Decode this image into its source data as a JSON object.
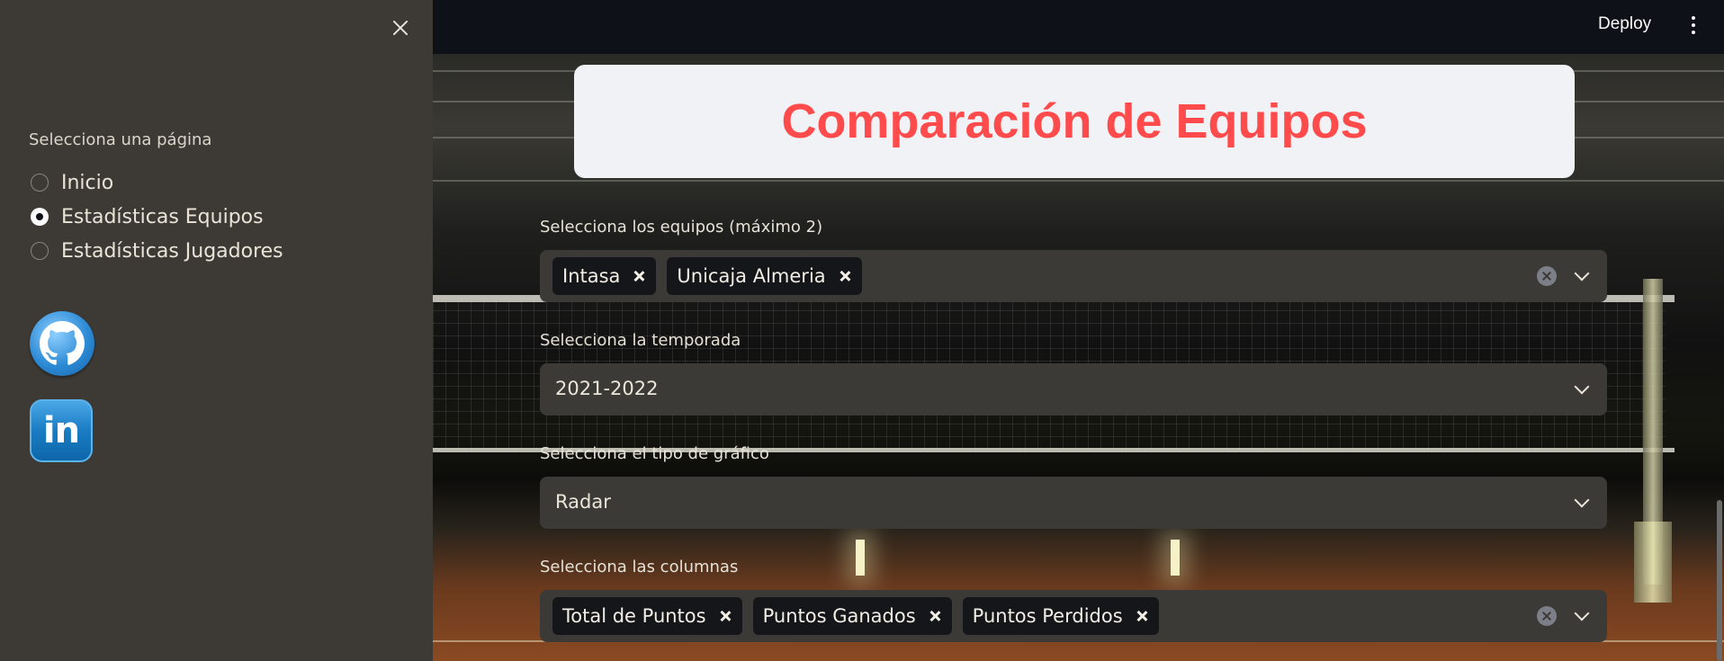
{
  "header": {
    "deploy_label": "Deploy"
  },
  "sidebar": {
    "nav_label": "Selecciona una página",
    "pages": [
      {
        "label": "Inicio",
        "selected": false
      },
      {
        "label": "Estadísticas Equipos",
        "selected": true
      },
      {
        "label": "Estadísticas Jugadores",
        "selected": false
      }
    ],
    "links": [
      {
        "icon": "github-icon"
      },
      {
        "icon": "linkedin-icon",
        "text": "in"
      }
    ]
  },
  "main": {
    "title": "Comparación de Equipos",
    "teams_select": {
      "label": "Selecciona los equipos (máximo 2)",
      "chips": [
        "Intasa",
        "Unicaja Almeria"
      ]
    },
    "season_select": {
      "label": "Selecciona la temporada",
      "value": "2021-2022"
    },
    "chart_type_select": {
      "label": "Selecciona el tipo de gráfico",
      "value": "Radar"
    },
    "columns_select": {
      "label": "Selecciona las columnas",
      "chips": [
        "Total de Puntos",
        "Puntos Ganados",
        "Puntos Perdidos"
      ]
    }
  },
  "colors": {
    "accent": "#ff4b4b",
    "sidebar_bg": "#3d3a36",
    "app_bg": "#0e1117"
  }
}
